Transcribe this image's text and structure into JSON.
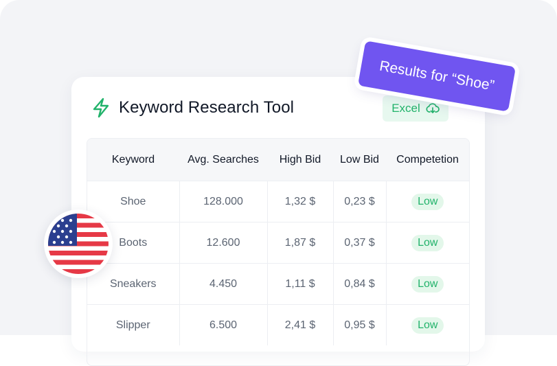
{
  "header": {
    "title": "Keyword Research Tool",
    "export_label": "Excel",
    "results_tag": "Results for “Shoe”"
  },
  "table": {
    "columns": [
      "Keyword",
      "Avg. Searches",
      "High Bid",
      "Low Bid",
      "Competetion"
    ],
    "rows": [
      {
        "keyword": "Shoe",
        "searches": "128.000",
        "high_bid": "1,32 $",
        "low_bid": "0,23 $",
        "competition": "Low"
      },
      {
        "keyword": "Boots",
        "searches": "12.600",
        "high_bid": "1,87 $",
        "low_bid": "0,37 $",
        "competition": "Low"
      },
      {
        "keyword": "Sneakers",
        "searches": "4.450",
        "high_bid": "1,11 $",
        "low_bid": "0,84 $",
        "competition": "Low"
      },
      {
        "keyword": "Slipper",
        "searches": "6.500",
        "high_bid": "2,41 $",
        "low_bid": "0,95 $",
        "competition": "Low"
      }
    ]
  },
  "icons": {
    "brand": "lightning-bolt-icon",
    "export": "cloud-download-icon",
    "country": "us-flag-icon"
  },
  "colors": {
    "accent_green": "#22b36b",
    "tag_purple": "#7055f0",
    "badge_bg": "#e3f7ea"
  }
}
